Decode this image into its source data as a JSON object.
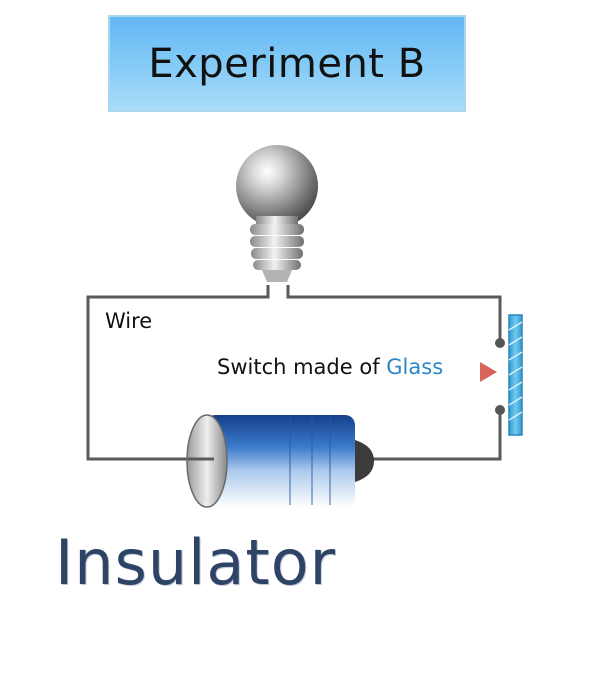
{
  "header": {
    "title": "Experiment B"
  },
  "labels": {
    "wire": "Wire",
    "switch_prefix": "Switch made of ",
    "switch_material": "Glass",
    "result": "Insulator"
  },
  "colors": {
    "title_bg": "#7cc4f5",
    "material_text": "#2b86c5",
    "result_text": "#2e4466",
    "switch_glass": "#4fb2dd",
    "arrow": "#d8645a",
    "wire": "#5a5a5a",
    "battery_body": "#3a78c5"
  },
  "icons": {
    "bulb": "light-bulb-icon",
    "battery": "battery-icon",
    "switch": "glass-switch-icon",
    "arrow": "arrow-right-icon"
  }
}
